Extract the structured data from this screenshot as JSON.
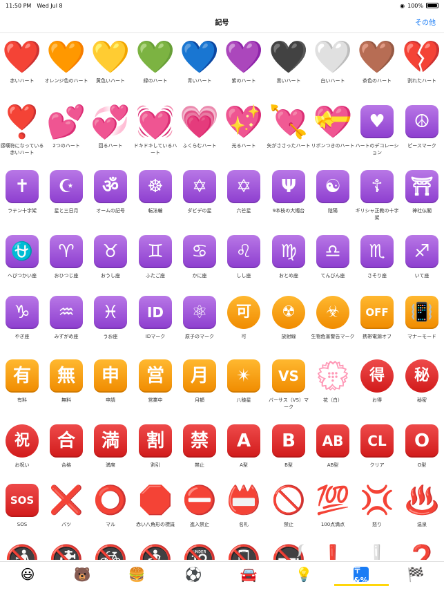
{
  "status": {
    "time": "11:50 PM",
    "date": "Wed Jul 8",
    "battery": "100%"
  },
  "nav": {
    "title": "記号",
    "other": "その他"
  },
  "rows": [
    [
      {
        "glyph": "❤️",
        "style": "heart",
        "label": "赤いハート"
      },
      {
        "glyph": "🧡",
        "style": "heart",
        "label": "オレンジ色のハート"
      },
      {
        "glyph": "💛",
        "style": "heart",
        "label": "黄色いハート"
      },
      {
        "glyph": "💚",
        "style": "heart",
        "label": "緑のハート"
      },
      {
        "glyph": "💙",
        "style": "heart",
        "label": "青いハート"
      },
      {
        "glyph": "💜",
        "style": "heart",
        "label": "紫のハート"
      },
      {
        "glyph": "🖤",
        "style": "heart",
        "label": "黒いハート"
      },
      {
        "glyph": "🤍",
        "style": "heart",
        "label": "白いハート"
      },
      {
        "glyph": "🤎",
        "style": "heart",
        "label": "茶色のハート"
      },
      {
        "glyph": "💔",
        "style": "heart",
        "label": "割れたハート"
      }
    ],
    [
      {
        "glyph": "❣️",
        "style": "heart",
        "label": "感嘆符になっている赤いハート"
      },
      {
        "glyph": "💕",
        "style": "heart",
        "label": "2つのハート"
      },
      {
        "glyph": "💞",
        "style": "heart",
        "label": "回るハート"
      },
      {
        "glyph": "💓",
        "style": "heart",
        "label": "ドキドキしているハート"
      },
      {
        "glyph": "💗",
        "style": "heart",
        "label": "ふくらむハート"
      },
      {
        "glyph": "💖",
        "style": "heart",
        "label": "光るハート"
      },
      {
        "glyph": "💘",
        "style": "heart",
        "label": "矢がささったハート"
      },
      {
        "glyph": "💝",
        "style": "heart",
        "label": "リボンつきのハート"
      },
      {
        "glyph": "♥",
        "style": "sq-purple",
        "label": "ハートのデコレーション"
      },
      {
        "glyph": "☮",
        "style": "sq-purple",
        "label": "ピースマーク"
      }
    ],
    [
      {
        "glyph": "✝",
        "style": "sq-purple",
        "label": "ラテン十字架"
      },
      {
        "glyph": "☪",
        "style": "sq-purple",
        "label": "星と三日月"
      },
      {
        "glyph": "ॐ",
        "style": "sq-purple",
        "label": "オームの記号"
      },
      {
        "glyph": "☸",
        "style": "sq-purple",
        "label": "転法輪"
      },
      {
        "glyph": "✡",
        "style": "sq-purple",
        "label": "ダビデの星"
      },
      {
        "glyph": "✡",
        "style": "sq-purple",
        "label": "六芒星"
      },
      {
        "glyph": "Ψ",
        "style": "sq-purple",
        "label": "9本枝の大燭台"
      },
      {
        "glyph": "☯",
        "style": "sq-purple",
        "label": "陰陽"
      },
      {
        "glyph": "☦",
        "style": "sq-purple",
        "label": "ギリシャ正教の十字架"
      },
      {
        "glyph": "⛩",
        "style": "sq-purple",
        "label": "神社仏閣"
      }
    ],
    [
      {
        "glyph": "⛎",
        "style": "sq-purple",
        "label": "へびつかい座"
      },
      {
        "glyph": "♈",
        "style": "sq-purple",
        "label": "おひつじ座"
      },
      {
        "glyph": "♉",
        "style": "sq-purple",
        "label": "おうし座"
      },
      {
        "glyph": "♊",
        "style": "sq-purple",
        "label": "ふたご座"
      },
      {
        "glyph": "♋",
        "style": "sq-purple",
        "label": "かに座"
      },
      {
        "glyph": "♌",
        "style": "sq-purple",
        "label": "しし座"
      },
      {
        "glyph": "♍",
        "style": "sq-purple",
        "label": "おとめ座"
      },
      {
        "glyph": "♎",
        "style": "sq-purple",
        "label": "てんびん座"
      },
      {
        "glyph": "♏",
        "style": "sq-purple",
        "label": "さそり座"
      },
      {
        "glyph": "♐",
        "style": "sq-purple",
        "label": "いて座"
      }
    ],
    [
      {
        "glyph": "♑",
        "style": "sq-purple",
        "label": "やぎ座"
      },
      {
        "glyph": "♒",
        "style": "sq-purple",
        "label": "みずがめ座"
      },
      {
        "glyph": "♓",
        "style": "sq-purple",
        "label": "うお座"
      },
      {
        "glyph": "ID",
        "style": "sq-purple",
        "label": "IDマーク"
      },
      {
        "glyph": "⚛",
        "style": "sq-purple",
        "label": "原子のマーク"
      },
      {
        "glyph": "可",
        "style": "circ-orange",
        "label": "可"
      },
      {
        "glyph": "☢",
        "style": "circ-orange",
        "label": "放射線"
      },
      {
        "glyph": "☣",
        "style": "circ-orange",
        "label": "生物危害警告マーク"
      },
      {
        "glyph": "OFF",
        "style": "sq-orange",
        "label": "携帯電源オフ"
      },
      {
        "glyph": "📳",
        "style": "sq-orange",
        "label": "マナーモード"
      }
    ],
    [
      {
        "glyph": "有",
        "style": "sq-orange",
        "label": "有料"
      },
      {
        "glyph": "無",
        "style": "sq-orange",
        "label": "無料"
      },
      {
        "glyph": "申",
        "style": "sq-orange",
        "label": "申請"
      },
      {
        "glyph": "営",
        "style": "sq-orange",
        "label": "営業中"
      },
      {
        "glyph": "月",
        "style": "sq-orange",
        "label": "月額"
      },
      {
        "glyph": "✴",
        "style": "sq-orange",
        "label": "八稜星"
      },
      {
        "glyph": "VS",
        "style": "sq-orange",
        "label": "バーサス（VS）マーク"
      },
      {
        "glyph": "💮",
        "style": "plain",
        "label": "花（白）"
      },
      {
        "glyph": "得",
        "style": "circ-red",
        "label": "お得"
      },
      {
        "glyph": "秘",
        "style": "circ-red",
        "label": "秘密"
      }
    ],
    [
      {
        "glyph": "祝",
        "style": "circ-red",
        "label": "お祝い"
      },
      {
        "glyph": "合",
        "style": "sq-red",
        "label": "合格"
      },
      {
        "glyph": "満",
        "style": "sq-red",
        "label": "満席"
      },
      {
        "glyph": "割",
        "style": "sq-red",
        "label": "割引"
      },
      {
        "glyph": "禁",
        "style": "sq-red",
        "label": "禁止"
      },
      {
        "glyph": "A",
        "style": "sq-red",
        "label": "A型"
      },
      {
        "glyph": "B",
        "style": "sq-red",
        "label": "B型"
      },
      {
        "glyph": "AB",
        "style": "sq-red",
        "label": "AB型"
      },
      {
        "glyph": "CL",
        "style": "sq-red",
        "label": "クリア"
      },
      {
        "glyph": "O",
        "style": "sq-red",
        "label": "O型"
      }
    ],
    [
      {
        "glyph": "SOS",
        "style": "sq-red",
        "label": "SOS"
      },
      {
        "glyph": "❌",
        "style": "plain",
        "label": "バツ"
      },
      {
        "glyph": "⭕",
        "style": "plain",
        "label": "マル"
      },
      {
        "glyph": "🛑",
        "style": "plain",
        "label": "赤い八角形の標識"
      },
      {
        "glyph": "⛔",
        "style": "plain",
        "label": "進入禁止"
      },
      {
        "glyph": "📛",
        "style": "plain",
        "label": "名札"
      },
      {
        "glyph": "🚫",
        "style": "plain",
        "label": "禁止"
      },
      {
        "glyph": "💯",
        "style": "plain",
        "label": "100点満点"
      },
      {
        "glyph": "💢",
        "style": "plain",
        "label": "怒り"
      },
      {
        "glyph": "♨️",
        "style": "plain",
        "label": "温泉"
      }
    ],
    [
      {
        "glyph": "🚯",
        "style": "plain",
        "label": ""
      },
      {
        "glyph": "🚱",
        "style": "plain",
        "label": ""
      },
      {
        "glyph": "🚳",
        "style": "plain",
        "label": ""
      },
      {
        "glyph": "🚷",
        "style": "plain",
        "label": ""
      },
      {
        "glyph": "🔞",
        "style": "plain",
        "label": ""
      },
      {
        "glyph": "📵",
        "style": "plain",
        "label": ""
      },
      {
        "glyph": "🚭",
        "style": "plain",
        "label": ""
      },
      {
        "glyph": "❗",
        "style": "plain",
        "label": ""
      },
      {
        "glyph": "❕",
        "style": "plain",
        "label": ""
      },
      {
        "glyph": "❓",
        "style": "plain",
        "label": ""
      }
    ]
  ],
  "tabs": [
    {
      "glyph": "😃",
      "name": "smileys"
    },
    {
      "glyph": "🐻",
      "name": "animals"
    },
    {
      "glyph": "🍔",
      "name": "food"
    },
    {
      "glyph": "⚽",
      "name": "activity"
    },
    {
      "glyph": "🚘",
      "name": "travel"
    },
    {
      "glyph": "💡",
      "name": "objects"
    },
    {
      "glyph": "〒&%",
      "name": "symbols"
    },
    {
      "glyph": "🏁",
      "name": "flags"
    }
  ]
}
